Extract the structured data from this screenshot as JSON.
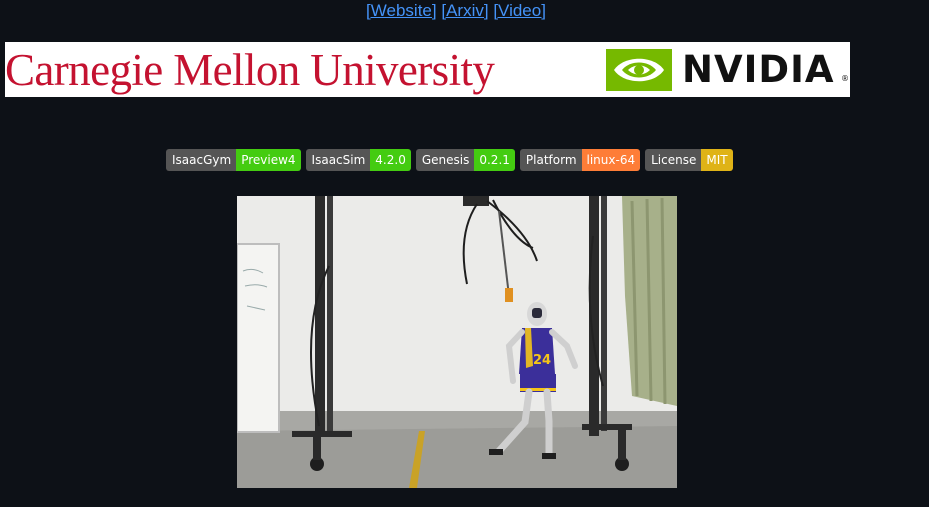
{
  "header_links": [
    {
      "label": "[Website]"
    },
    {
      "label": "[Arxiv]"
    },
    {
      "label": "[Video]"
    }
  ],
  "banner": {
    "university": "Carnegie Mellon University",
    "company": "NVIDIA",
    "trademark": "®"
  },
  "badges": [
    {
      "label": "IsaacGym",
      "value": "Preview4",
      "color": "#4c1"
    },
    {
      "label": "IsaacSim",
      "value": "4.2.0",
      "color": "#4c1"
    },
    {
      "label": "Genesis",
      "value": "0.2.1",
      "color": "#4c1"
    },
    {
      "label": "Platform",
      "value": "linux-64",
      "color": "#fe7d37"
    },
    {
      "label": "License",
      "value": "MIT",
      "color": "#dfb317"
    }
  ],
  "video": {
    "jersey_number": "24"
  },
  "colors": {
    "background": "#0d1117",
    "link": "#4493f8",
    "cmu_red": "#c41230",
    "nvidia_green": "#76b900"
  }
}
